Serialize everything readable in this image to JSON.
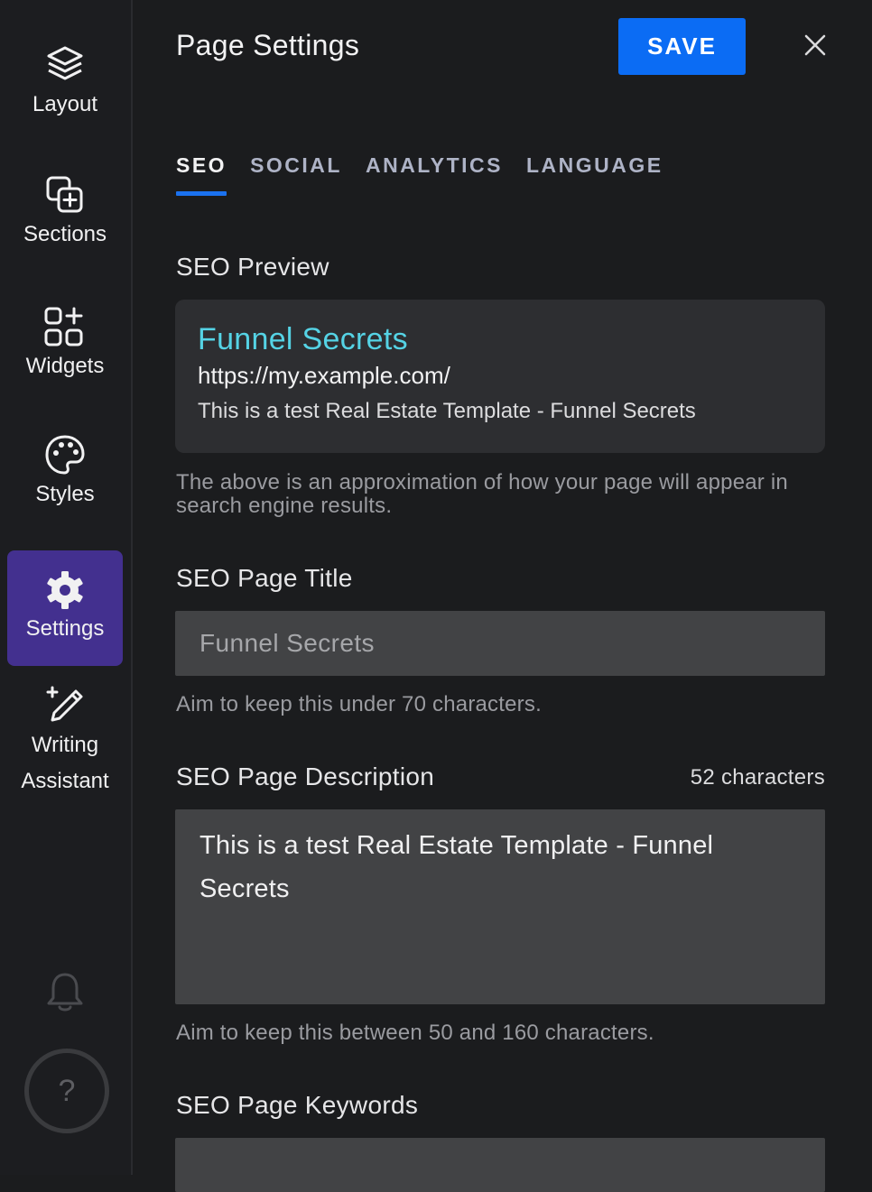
{
  "sidebar": {
    "items": [
      {
        "label": "Layout",
        "icon": "layers-icon"
      },
      {
        "label": "Sections",
        "icon": "add-section-icon"
      },
      {
        "label": "Widgets",
        "icon": "widgets-icon"
      },
      {
        "label": "Styles",
        "icon": "palette-icon"
      },
      {
        "label": "Settings",
        "icon": "gear-icon",
        "active": true
      },
      {
        "label_line1": "Writing",
        "label_line2": "Assistant",
        "icon": "magic-pen-icon"
      }
    ],
    "bell_icon": "bell-icon",
    "help_label": "?"
  },
  "header": {
    "title": "Page Settings",
    "save_label": "SAVE",
    "close_icon": "close-icon"
  },
  "tabs": [
    {
      "label": "SEO",
      "active": true
    },
    {
      "label": "SOCIAL"
    },
    {
      "label": "ANALYTICS"
    },
    {
      "label": "LANGUAGE"
    }
  ],
  "seo": {
    "preview_label": "SEO Preview",
    "preview": {
      "title": "Funnel Secrets",
      "url": "https://my.example.com/",
      "description": "This is a test Real Estate Template - Funnel Secrets"
    },
    "preview_note": "The above is an approximation of how your page will appear in search engine results.",
    "page_title_label": "SEO Page Title",
    "page_title_value": "Funnel Secrets",
    "page_title_hint": "Aim to keep this under 70 characters.",
    "page_description_label": "SEO Page Description",
    "page_description_count": "52 characters",
    "page_description_value": "This is a test Real Estate Template - Funnel Secrets",
    "page_description_hint": "Aim to keep this between 50 and 160 characters.",
    "page_keywords_label": "SEO Page Keywords"
  },
  "colors": {
    "accent": "#0b6cf4",
    "active_nav": "#43308f",
    "preview_link": "#55d3e5"
  }
}
